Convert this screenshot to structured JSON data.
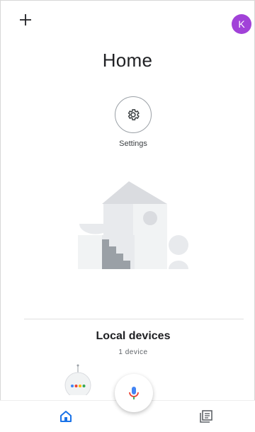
{
  "header": {
    "add_icon": "plus-icon",
    "avatar_initial": "K",
    "avatar_color": "#a142d8"
  },
  "page": {
    "title": "Home"
  },
  "settings": {
    "label": "Settings",
    "icon": "gear-icon"
  },
  "local_devices": {
    "title": "Local devices",
    "count_text": "1 device"
  },
  "assistant": {
    "mic_icon": "mic-icon",
    "colors": [
      "#4285f4",
      "#ea4335",
      "#fbbc05",
      "#34a853"
    ]
  },
  "bottom_nav": {
    "items": [
      {
        "icon": "home-icon",
        "active": true,
        "color": "#1a73e8"
      },
      {
        "icon": "feed-icon",
        "active": false,
        "color": "#5f6368"
      }
    ]
  }
}
